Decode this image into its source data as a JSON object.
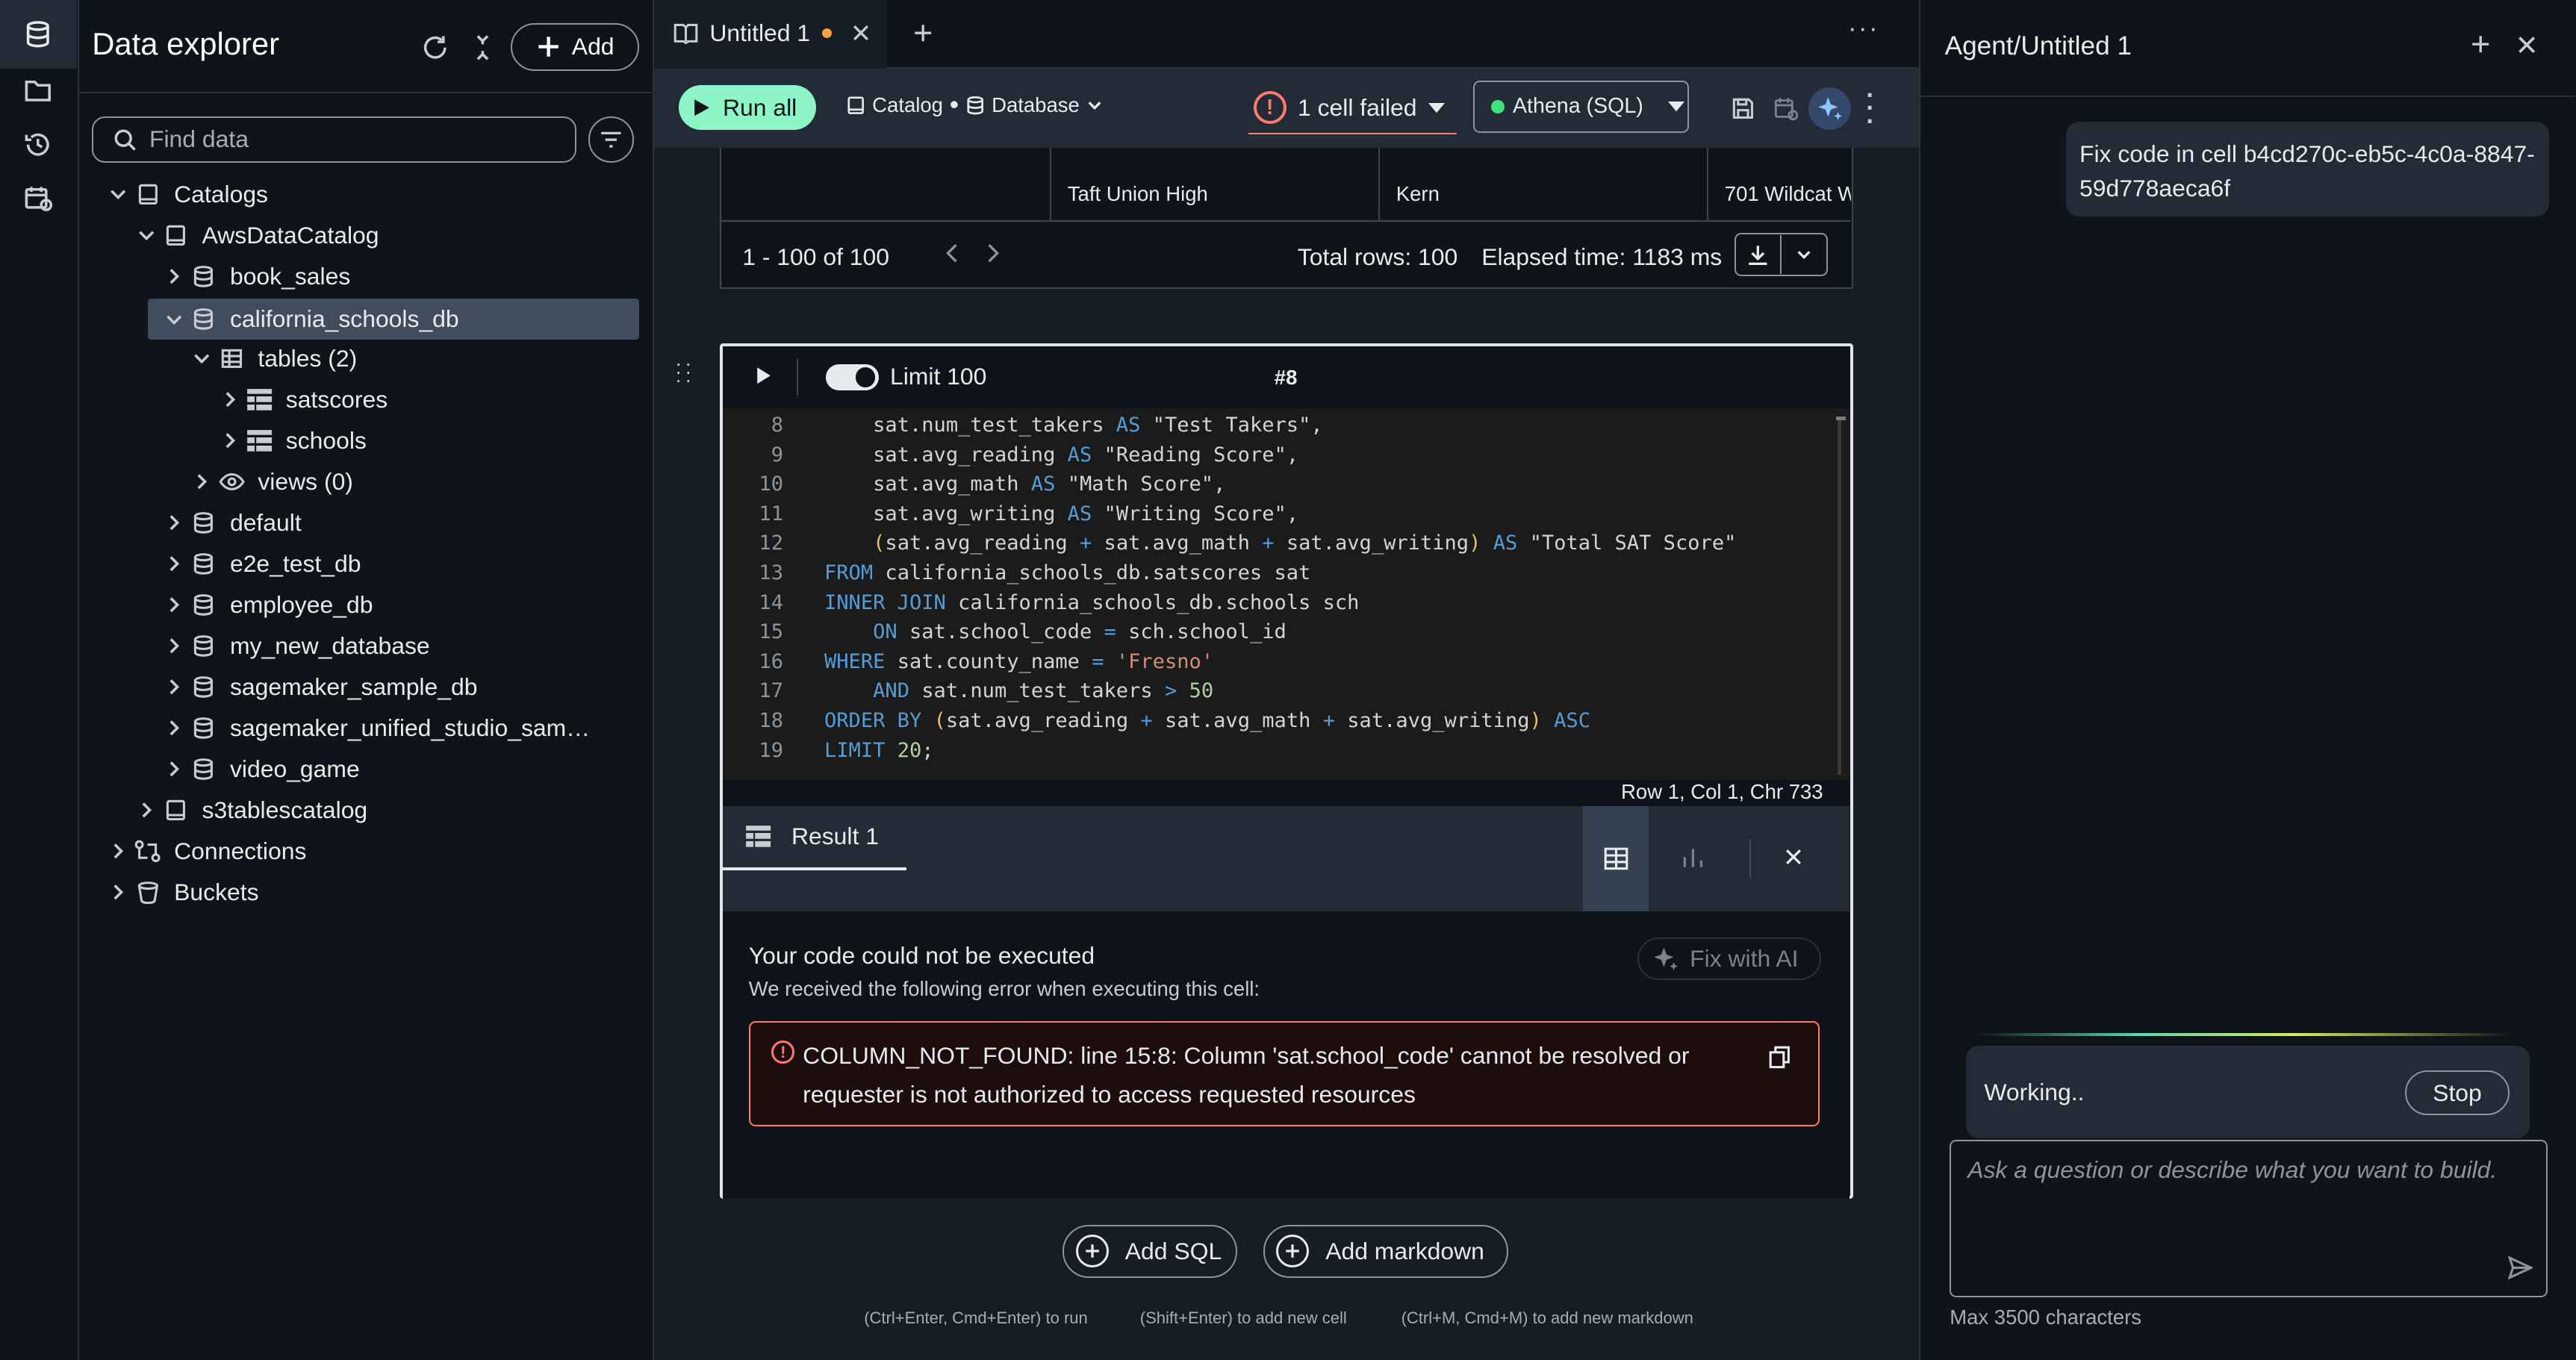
{
  "explorer": {
    "title": "Data explorer",
    "add_label": "Add",
    "search_placeholder": "Find data",
    "tree": [
      {
        "label": "Catalogs"
      },
      {
        "label": "AwsDataCatalog"
      },
      {
        "label": "book_sales"
      },
      {
        "label": "california_schools_db"
      },
      {
        "label": "tables (2)"
      },
      {
        "label": "satscores"
      },
      {
        "label": "schools"
      },
      {
        "label": "views (0)"
      },
      {
        "label": "default"
      },
      {
        "label": "e2e_test_db"
      },
      {
        "label": "employee_db"
      },
      {
        "label": "my_new_database"
      },
      {
        "label": "sagemaker_sample_db"
      },
      {
        "label": "sagemaker_unified_studio_sam…"
      },
      {
        "label": "video_game"
      },
      {
        "label": "s3tablescatalog"
      },
      {
        "label": "Connections"
      },
      {
        "label": "Buckets"
      }
    ]
  },
  "tabs": {
    "active_label": "Untitled 1",
    "more": "···"
  },
  "toolbar": {
    "run_all": "Run all",
    "catalog": "Catalog",
    "database": "Database",
    "failed": "1 cell failed",
    "engine": "Athena (SQL)"
  },
  "prev_result": {
    "cells": [
      "Taft Union High",
      "Kern",
      "701 Wildcat W"
    ],
    "range": "1 - 100 of 100",
    "total_rows": "Total rows: 100",
    "elapsed": "Elapsed time: 1183 ms"
  },
  "cell": {
    "limit_label": "Limit 100",
    "cell_id": "#8",
    "status_bar": "Row 1,  Col 1,  Chr 733",
    "code_lines": [
      {
        "n": "8"
      },
      {
        "n": "9"
      },
      {
        "n": "10"
      },
      {
        "n": "11"
      },
      {
        "n": "12"
      },
      {
        "n": "13"
      },
      {
        "n": "14"
      },
      {
        "n": "15"
      },
      {
        "n": "16"
      },
      {
        "n": "17"
      },
      {
        "n": "18"
      },
      {
        "n": "19"
      }
    ],
    "result_tab": "Result 1",
    "error_title": "Your code could not be executed",
    "error_subtitle": "We received the following error when executing this cell:",
    "fix_with_ai": "Fix with AI",
    "error_message": "COLUMN_NOT_FOUND: line 15:8: Column 'sat.school_code' cannot be resolved or requester is not authorized to access requested resources"
  },
  "add_buttons": {
    "add_sql": "Add SQL",
    "add_markdown": "Add markdown"
  },
  "hints": {
    "run": "(Ctrl+Enter, Cmd+Enter) to run",
    "new_cell": "(Shift+Enter) to add new cell",
    "new_markdown": "(Ctrl+M, Cmd+M) to add new markdown"
  },
  "agent": {
    "title": "Agent/Untitled 1",
    "user_message": "Fix code in cell b4cd270c-eb5c-4c0a-8847-59d778aeca6f",
    "working": "Working..",
    "stop": "Stop",
    "input_placeholder": "Ask a question or describe what you want to build.",
    "char_limit": "Max 3500 characters"
  },
  "colors": {
    "accent": "#8ef5c6",
    "error_border": "#ff7a6f",
    "error_bg": "#1e0d0e",
    "link_blue": "#569cd6"
  }
}
